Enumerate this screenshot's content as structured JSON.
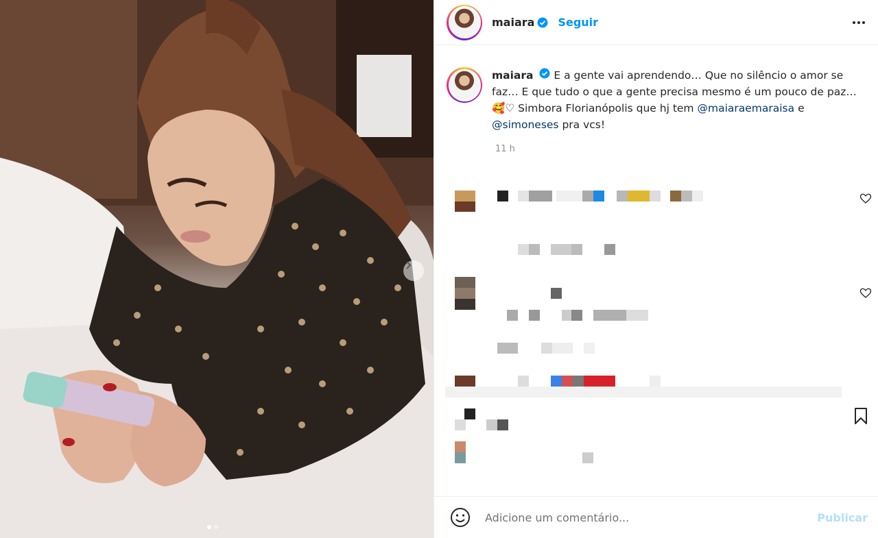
{
  "post": {
    "username": "maiara",
    "follow_label": "Seguir",
    "caption_user": "maiara",
    "caption_line1": "E a gente vai aprendendo… Que no silêncio o amor se",
    "caption_line2": "faz… E que tudo o que a gente precisa mesmo é um pouco de paz…",
    "caption_emoji": "🥰♡",
    "caption_line3_a": "Simbora Florianópolis que hj tem",
    "mention1": "@maiaraemaraisa",
    "caption_and": "e",
    "mention2": "@simoneses",
    "caption_end": "pra vcs!",
    "time_ago": "11 h"
  },
  "comment_box": {
    "placeholder": "Adicione um comentário...",
    "publish_label": "Publicar"
  },
  "colors": {
    "accent": "#0095f6",
    "mention": "#00376b",
    "muted": "#8e8e8e",
    "publish_disabled": "#b2dffc"
  },
  "icons": [
    "verified-icon",
    "more-icon",
    "heart-icon",
    "save-icon",
    "emoji-icon",
    "chevron-right-icon"
  ],
  "carousel": {
    "slides": 2,
    "current": 1
  }
}
